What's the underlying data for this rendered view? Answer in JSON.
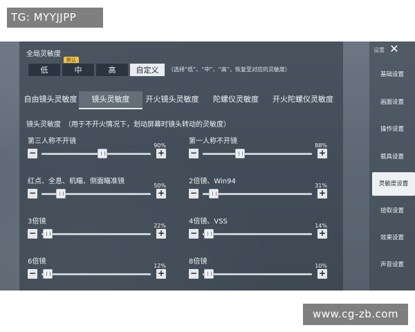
{
  "watermarks": {
    "tg": "TG: MYYJJPP",
    "site": "www.cg-zb.com"
  },
  "global": {
    "title": "全局灵敏度",
    "presets": [
      "低",
      "中",
      "高",
      "自定义"
    ],
    "active_preset": "自定义",
    "default_badge": "默认",
    "hint": "（选择“低”、“中”、“高”，恢复至对应的灵敏度）"
  },
  "tabs": [
    "自由镜头灵敏度",
    "镜头灵敏度",
    "开火镜头灵敏度",
    "陀螺仪灵敏度",
    "开火陀螺仪灵敏度"
  ],
  "active_tab": "镜头灵敏度",
  "section_title": "镜头灵敏度　（用于不开火情况下，划动屏幕时镜头转动的灵敏度）",
  "sliders": [
    {
      "label": "第三人称不开镜",
      "value": "90%",
      "level": 0.56
    },
    {
      "label": "第一人称不开镜",
      "value": "88%",
      "level": 0.34
    },
    {
      "label": "红点、全息、机瞄、侧面瞄准镜",
      "value": "50%",
      "level": 0.18
    },
    {
      "label": "2倍镜、Win94",
      "value": "31%",
      "level": 0.1
    },
    {
      "label": "3倍镜",
      "value": "22%",
      "level": 0.06
    },
    {
      "label": "4倍镜、VSS",
      "value": "14%",
      "level": 0.06
    },
    {
      "label": "6倍镜",
      "value": "12%",
      "level": 0.06
    },
    {
      "label": "8倍镜",
      "value": "10%",
      "level": 0.06
    }
  ],
  "sidebar": {
    "settings_label": "设置",
    "items": [
      "基础设置",
      "画面设置",
      "操作设置",
      "载具设置",
      "灵敏度设置",
      "拾取设置",
      "效果设置",
      "声音设置"
    ],
    "active": "灵敏度设置"
  },
  "controls": {
    "minus": "−",
    "plus": "+",
    "close": "✕"
  }
}
